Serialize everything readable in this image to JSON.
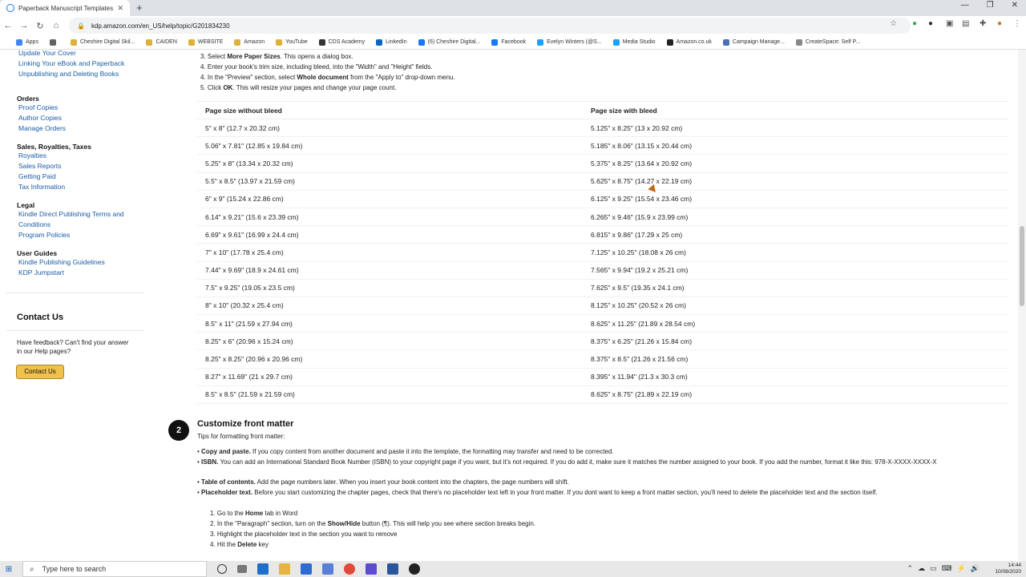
{
  "browser": {
    "tab_title": "Paperback Manuscript Templates",
    "url": "kdp.amazon.com/en_US/help/topic/G201834230",
    "bookmarks": [
      {
        "label": "Apps",
        "color": "#4285f4"
      },
      {
        "label": "",
        "color": "#5f6368"
      },
      {
        "label": "Cheshire Digital Skil...",
        "color": "#e0b13a"
      },
      {
        "label": "CAIDEN",
        "color": "#e0b13a"
      },
      {
        "label": "WEBSITE",
        "color": "#e0b13a"
      },
      {
        "label": "Amazon",
        "color": "#e0b13a"
      },
      {
        "label": "YouTube",
        "color": "#e0b13a"
      },
      {
        "label": "CDS Academy",
        "color": "#333333"
      },
      {
        "label": "LinkedIn",
        "color": "#0a66c2"
      },
      {
        "label": "(6) Cheshire Digital...",
        "color": "#1877f2"
      },
      {
        "label": "Facebook",
        "color": "#1877f2"
      },
      {
        "label": "Evelyn Winters (@S...",
        "color": "#1da1f2"
      },
      {
        "label": "Media Studio",
        "color": "#1da1f2"
      },
      {
        "label": "Amazon.co.uk",
        "color": "#222222"
      },
      {
        "label": "Campaign Manage...",
        "color": "#4a6fb5"
      },
      {
        "label": "CreateSpace: Self P...",
        "color": "#888888"
      }
    ]
  },
  "sidebar": {
    "top_links": [
      "Update Your Cover",
      "Linking Your eBook and Paperback",
      "Unpublishing and Deleting Books"
    ],
    "sections": [
      {
        "title": "Orders",
        "links": [
          "Proof Copies",
          "Author Copies",
          "Manage Orders"
        ]
      },
      {
        "title": "Sales, Royalties, Taxes",
        "links": [
          "Royalties",
          "Sales Reports",
          "Getting Paid",
          "Tax Information"
        ]
      },
      {
        "title": "Legal",
        "links": [
          "Kindle Direct Publishing Terms and",
          "Conditions",
          "Program Policies"
        ]
      },
      {
        "title": "User Guides",
        "links": [
          "Kindle Publishing Guidelines",
          "KDP Jumpstart"
        ]
      }
    ],
    "contact": {
      "title": "Contact Us",
      "text": "Have feedback? Can't find your answer in our Help pages?",
      "button": "Contact Us"
    }
  },
  "steps_top": [
    {
      "pre": "3. Select ",
      "bold": "More Paper Sizes",
      "post": ". This opens a dialog box."
    },
    {
      "pre": "4. Enter your book's trim size, including bleed, into the \"Width\" and \"Height\" fields.",
      "bold": "",
      "post": ""
    },
    {
      "pre": "4. In the \"Preview\" section, select ",
      "bold": "Whole document",
      "post": " from the \"Apply to\" drop-down menu."
    },
    {
      "pre": "5. Click ",
      "bold": "OK",
      "post": ". This will resize your pages and change your page count."
    }
  ],
  "table": {
    "headers": [
      "Page size without bleed",
      "Page size with bleed"
    ],
    "rows": [
      [
        "5\" x 8\" (12.7 x 20.32 cm)",
        "5.125\" x 8.25\" (13 x 20.92 cm)"
      ],
      [
        "5.06\" x 7.81\" (12.85 x 19.84 cm)",
        "5.185\" x 8.06\" (13.15 x 20.44 cm)"
      ],
      [
        "5.25\" x 8\" (13.34 x 20.32 cm)",
        "5.375\" x 8.25\" (13.64 x 20.92 cm)"
      ],
      [
        "5.5\" x 8.5\" (13.97 x 21.59 cm)",
        "5.625\" x 8.75\" (14.27 x 22.19 cm)"
      ],
      [
        "6\" x 9\" (15.24 x 22.86 cm)",
        "6.125\" x 9.25\" (15.54 x 23.46 cm)"
      ],
      [
        "6.14\" x 9.21\" (15.6 x 23.39 cm)",
        "6.265\" x 9.46\" (15.9 x 23.99 cm)"
      ],
      [
        "6.69\" x 9.61\" (16.99 x 24.4 cm)",
        "6.815\" x 9.86\" (17.29 x 25 cm)"
      ],
      [
        "7\" x 10\" (17.78 x 25.4 cm)",
        "7.125\" x 10.25\" (18.08 x 26 cm)"
      ],
      [
        "7.44\" x 9.69\" (18.9 x 24.61 cm)",
        "7.565\" x 9.94\" (19.2 x 25.21 cm)"
      ],
      [
        "7.5\" x 9.25\" (19.05 x 23.5 cm)",
        "7.625\" x 9.5\" (19.35 x 24.1 cm)"
      ],
      [
        "8\" x 10\" (20.32 x 25.4 cm)",
        "8.125\" x 10.25\" (20.52 x 26 cm)"
      ],
      [
        "8.5\" x 11\" (21.59 x 27.94 cm)",
        "8.625\" x 11.25\" (21.89 x 28.54 cm)"
      ],
      [
        "8.25\" x 6\" (20.96 x 15.24 cm)",
        "8.375\" x 6.25\" (21.26 x 15.84 cm)"
      ],
      [
        "8.25\" x 8.25\" (20.96 x 20.96 cm)",
        "8.375\" x 8.5\" (21.26 x 21.56 cm)"
      ],
      [
        "8.27\" x 11.69\" (21 x 29.7 cm)",
        "8.395\" x 11.94\" (21.3 x 30.3 cm)"
      ],
      [
        "8.5\" x 8.5\" (21.59 x 21.59 cm)",
        "8.625\" x 8.75\" (21.89 x 22.19 cm)"
      ]
    ]
  },
  "step2": {
    "number": "2",
    "title": "Customize front matter",
    "subtitle": "Tips for formatting front matter:",
    "bullets": [
      {
        "bold": "Copy and paste.",
        "text": " If you copy content from another document and paste it into the template, the formatting may transfer and need to be corrected."
      },
      {
        "bold": "ISBN.",
        "text": " You can add an International Standard Book Number (ISBN) to your copyright page if you want, but it's not required. If you do add it, make sure it matches the number assigned to your book. If you add the number, format it like this: 978-X-XXXX-XXXX-X"
      },
      {
        "bold": "Table of contents.",
        "text": " Add the page numbers later. When you insert your book content into the chapters, the page numbers will shift."
      },
      {
        "bold": "Placeholder text.",
        "text": " Before you start customizing the chapter pages, check that there's no placeholder text left in your front matter. If you dont want to keep a front matter section, you'll need to delete the placeholder text and the section itself."
      }
    ],
    "substeps": [
      {
        "pre": "1. Go to the ",
        "bold": "Home",
        "post": " tab in Word"
      },
      {
        "pre": "2. In the \"Paragraph\" section, turn on the ",
        "bold": "Show/Hide",
        "post": " button (¶). This will help you see where section breaks begin."
      },
      {
        "pre": "3. Highlight the placeholder text in the section you want to remove",
        "bold": "",
        "post": ""
      },
      {
        "pre": "4. Hit the ",
        "bold": "Delete",
        "post": " key"
      }
    ]
  },
  "taskbar": {
    "search_placeholder": "Type here to search",
    "time": "14:44",
    "date": "10/08/2020"
  }
}
